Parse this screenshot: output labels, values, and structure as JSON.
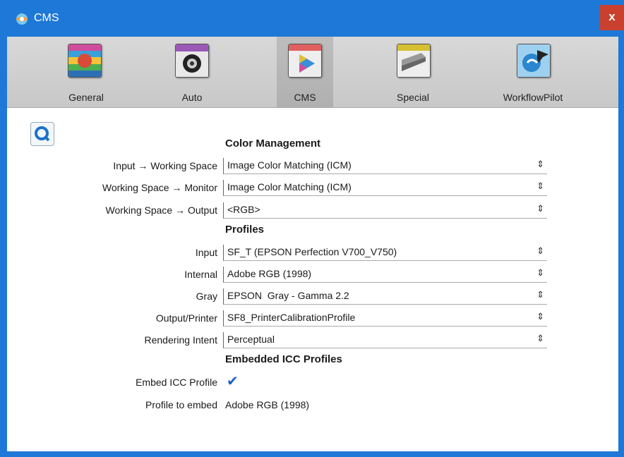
{
  "window": {
    "title": "CMS",
    "close_label": "x"
  },
  "toolbar": {
    "items": [
      {
        "label": "General",
        "icon": "general-rgb-icon"
      },
      {
        "label": "Auto",
        "icon": "auto-aperture-icon"
      },
      {
        "label": "CMS",
        "icon": "cms-color-icon",
        "active": true
      },
      {
        "label": "Special",
        "icon": "scanner-icon"
      },
      {
        "label": "WorkflowPilot",
        "icon": "workflow-pilot-icon"
      }
    ]
  },
  "sections": {
    "color_management": "Color Management",
    "profiles": "Profiles",
    "embedded": "Embedded ICC Profiles"
  },
  "color_management": {
    "input_working_label": "Input → Working Space",
    "input_working_value": "Image Color Matching (ICM)",
    "working_monitor_label": "Working Space → Monitor",
    "working_monitor_value": "Image Color Matching (ICM)",
    "working_output_label": "Working Space → Output",
    "working_output_value": "<RGB>"
  },
  "profiles": {
    "input_label": "Input",
    "input_value": "SF_T (EPSON Perfection V700_V750)",
    "internal_label": "Internal",
    "internal_value": "Adobe RGB (1998)",
    "gray_label": "Gray",
    "gray_value": "EPSON  Gray - Gamma 2.2",
    "output_label": "Output/Printer",
    "output_value": "SF8_PrinterCalibrationProfile",
    "intent_label": "Rendering Intent",
    "intent_value": "Perceptual"
  },
  "embedded": {
    "embed_label": "Embed ICC Profile",
    "embed_checked": true,
    "profile_label": "Profile to embed",
    "profile_value": "Adobe RGB (1998)"
  },
  "colors": {
    "titlebar": "#1e78d7",
    "close": "#c9402e",
    "accent": "#1662c4"
  }
}
